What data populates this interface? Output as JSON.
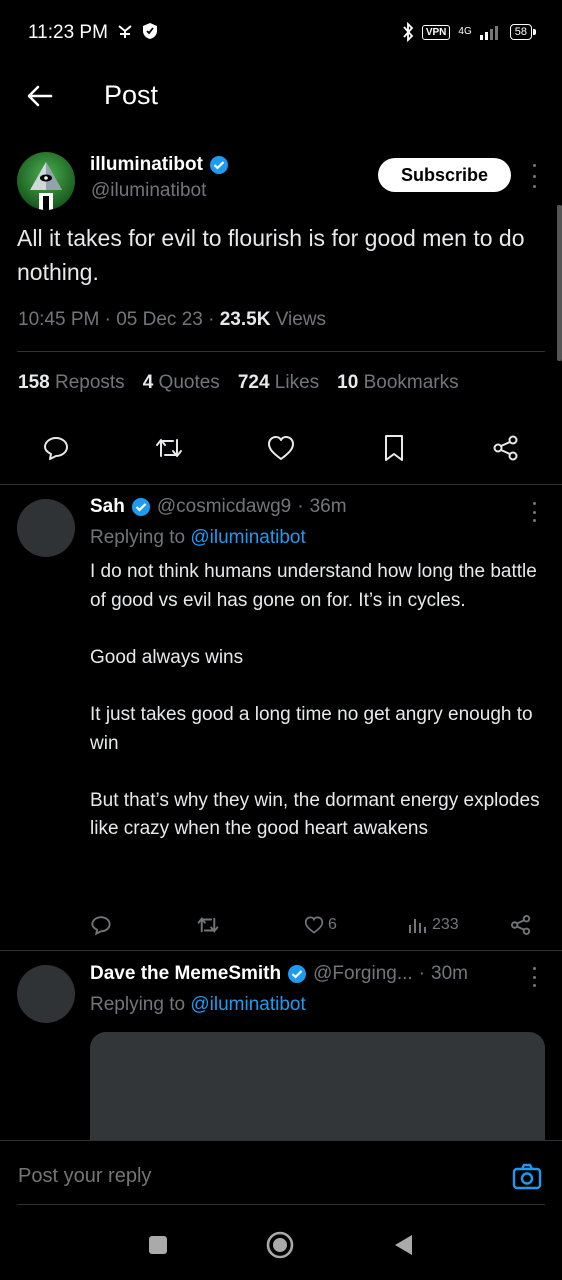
{
  "status_bar": {
    "time": "11:23 PM",
    "vpn": "VPN",
    "network": "4G",
    "battery": "58"
  },
  "topbar": {
    "title": "Post"
  },
  "post": {
    "author_name": "illuminatibot",
    "author_handle": "@iluminatibot",
    "subscribe_label": "Subscribe",
    "text": "All it takes for evil to flourish is for good men to do nothing.",
    "time": "10:45 PM",
    "date": "05 Dec 23",
    "views_count": "23.5K",
    "views_label": "Views",
    "stats": {
      "reposts_count": "158",
      "reposts_label": "Reposts",
      "quotes_count": "4",
      "quotes_label": "Quotes",
      "likes_count": "724",
      "likes_label": "Likes",
      "bookmarks_count": "10",
      "bookmarks_label": "Bookmarks"
    }
  },
  "replies": [
    {
      "name": "Sah",
      "handle": "@cosmicdawg9",
      "age": "36m",
      "replying_prefix": "Replying to",
      "replying_to": "@iluminatibot",
      "body": "I do not think humans understand how long the battle of good vs evil has gone on for. It’s in cycles.\n\nGood always wins\n\nIt just takes good a long time no get angry enough to win\n\nBut that’s why they win, the dormant energy explodes like crazy when the good heart awakens",
      "likes": "6",
      "views": "233"
    },
    {
      "name": "Dave the MemeSmith",
      "handle": "@Forging...",
      "age": "30m",
      "replying_prefix": "Replying to",
      "replying_to": "@iluminatibot"
    }
  ],
  "composer": {
    "placeholder": "Post your reply"
  },
  "colors": {
    "accent": "#1d9bf0",
    "muted": "#71767b",
    "text": "#e7e9ea",
    "background": "#000000",
    "divider": "#2f3336"
  }
}
